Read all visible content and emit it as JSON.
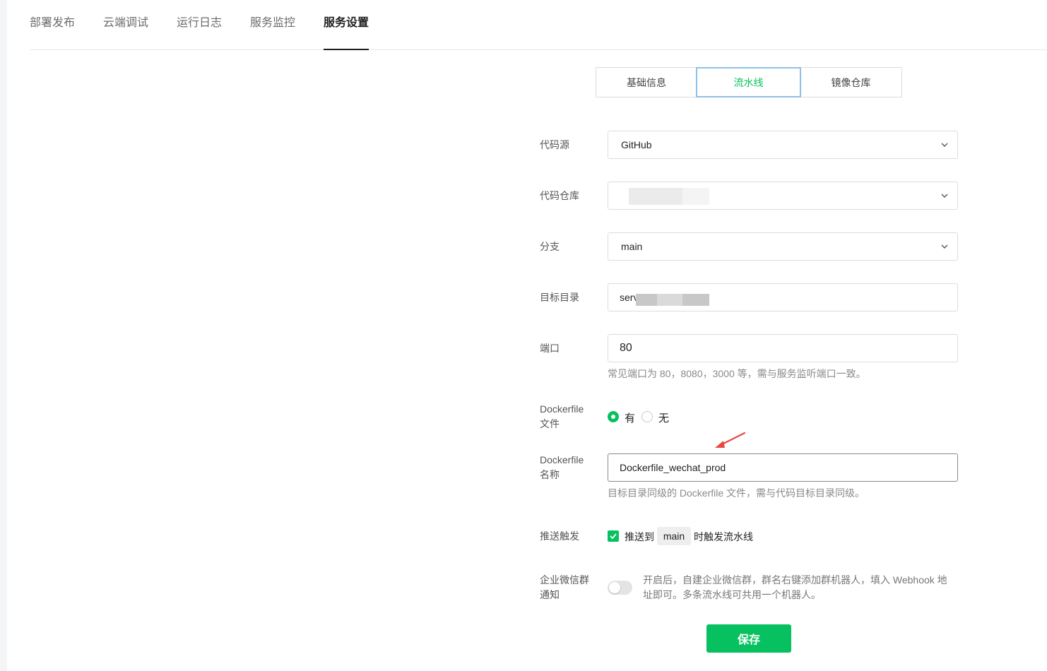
{
  "top_tabs": [
    "部署发布",
    "云端调试",
    "运行日志",
    "服务监控",
    "服务设置"
  ],
  "active_top_tab": "服务设置",
  "segments": [
    "基础信息",
    "流水线",
    "镜像仓库"
  ],
  "active_segment": "流水线",
  "form": {
    "source_label": "代码源",
    "source_value": "GitHub",
    "repo_label": "代码仓库",
    "repo_value": "",
    "branch_label": "分支",
    "branch_value": "main",
    "target_dir_label": "目标目录",
    "target_dir_value": "serv",
    "port_label": "端口",
    "port_value": "80",
    "port_hint": "常见端口为 80，8080，3000 等，需与服务监听端口一致。",
    "dockerfile_label_1": "Dockerfile",
    "dockerfile_label_2": "文件",
    "dockerfile_yes": "有",
    "dockerfile_no": "无",
    "dockerfile_selected": "有",
    "dockerfile_name_label_1": "Dockerfile",
    "dockerfile_name_label_2": "名称",
    "dockerfile_name_value": "Dockerfile_wechat_prod",
    "dockerfile_name_hint": "目标目录同级的 Dockerfile 文件，需与代码目标目录同级。",
    "push_trigger_label": "推送触发",
    "push_checked": true,
    "push_prefix": "推送到",
    "push_branch": "main",
    "push_suffix": "时触发流水线",
    "wecom_label_1": "企业微信群",
    "wecom_label_2": "通知",
    "wecom_enabled": false,
    "wecom_hint": "开启后，自建企业微信群，群名右键添加群机器人，填入 Webhook 地址即可。多条流水线可共用一个机器人。"
  },
  "save_label": "保存",
  "colors": {
    "accent": "#07c160",
    "focus_border": "#8ec0e8",
    "annotation_arrow": "#e9483f"
  }
}
